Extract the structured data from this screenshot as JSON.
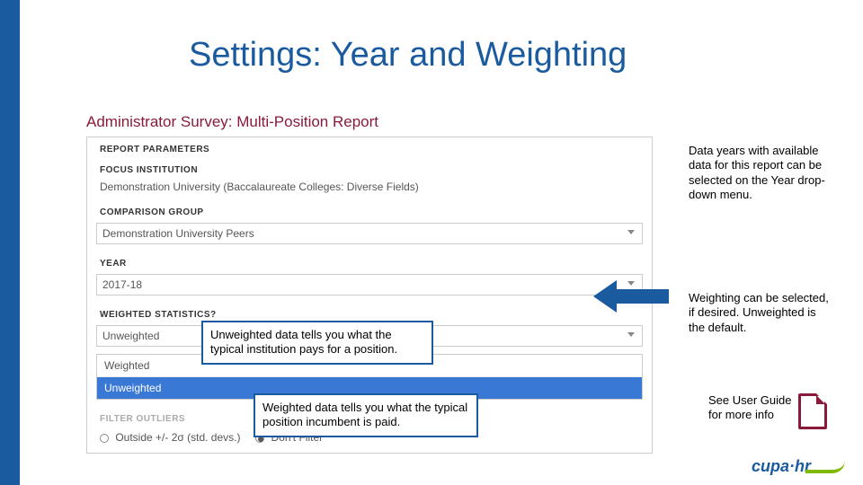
{
  "title": "Settings: Year and Weighting",
  "survey_title": "Administrator Survey: Multi-Position Report",
  "panel": {
    "report_params_label": "REPORT PARAMETERS",
    "focus_label": "FOCUS INSTITUTION",
    "focus_value": "Demonstration University (Baccalaureate Colleges: Diverse Fields)",
    "comp_label": "COMPARISON GROUP",
    "comp_value": "Demonstration University Peers",
    "year_label": "YEAR",
    "year_value": "2017-18",
    "weighted_label": "WEIGHTED STATISTICS?",
    "weighted_value": "Unweighted",
    "options": {
      "weighted": "Weighted",
      "unweighted": "Unweighted"
    },
    "filter_label": "FILTER OUTLIERS",
    "filter_opt1": "Outside +/- 2σ (std. devs.)",
    "filter_opt2": "Don't Filter"
  },
  "notes": {
    "data_years": "Data years with available data for this report can be selected on the Year drop-down menu.",
    "weighting": "Weighting can be selected, if desired. Unweighted is the default.",
    "unweighted_callout": "Unweighted data tells you what the typical institution pays for a position.",
    "weighted_callout": "Weighted data tells you what the typical position incumbent is paid.",
    "user_guide": "See User Guide for more info"
  },
  "logo": "cupa·hr"
}
